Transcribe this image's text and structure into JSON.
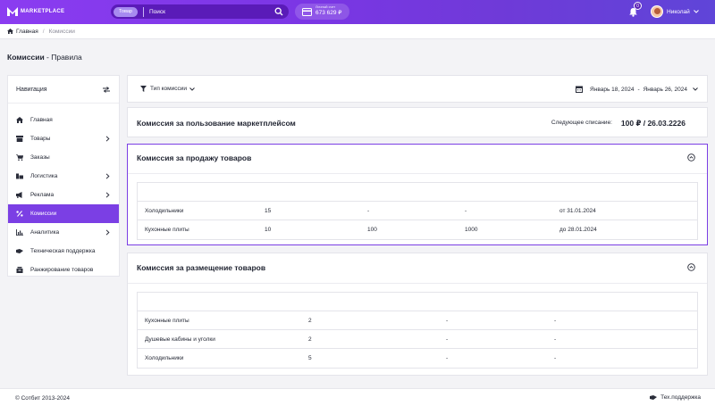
{
  "header": {
    "logo_text": "MARKETPLACE",
    "search_scope": "Товар",
    "search_placeholder": "Поиск",
    "wallet_label": "Личный счет",
    "wallet_amount": "673 629 ₽",
    "notifications_count": "0",
    "user_name": "Николай",
    "accent": "#7b3fe4"
  },
  "breadcrumb": {
    "home": "Главная",
    "sep": "/",
    "current": "Комиссии"
  },
  "page": {
    "title_bold": "Комиссии",
    "title_rest": " - Правила"
  },
  "sidebar": {
    "title": "Навигация",
    "items": [
      {
        "label": "Главная",
        "icon": "home-icon"
      },
      {
        "label": "Товары",
        "icon": "box-icon",
        "has_children": true
      },
      {
        "label": "Заказы",
        "icon": "cart-icon"
      },
      {
        "label": "Логистика",
        "icon": "truck-icon",
        "has_children": true
      },
      {
        "label": "Реклама",
        "icon": "megaphone-icon",
        "has_children": true
      },
      {
        "label": "Комиссии",
        "icon": "percent-icon",
        "active": true
      },
      {
        "label": "Аналитика",
        "icon": "chart-icon",
        "has_children": true
      },
      {
        "label": "Техническая поддержка",
        "icon": "support-icon"
      },
      {
        "label": "Ранжирование товаров",
        "icon": "ranking-icon"
      }
    ]
  },
  "filters": {
    "type_label": "Тип комиссии",
    "date_from": "Январь 18, 2024",
    "date_sep": "-",
    "date_to": "Январь 26, 2024"
  },
  "marketplace_fee": {
    "title": "Комиссия за пользование маркетплейсом",
    "next_label": "Следующее списание:",
    "next_value": "100 ₽ / 26.03.2226"
  },
  "sale_fee": {
    "title": "Комиссия за продажу товаров",
    "rows": [
      [
        "Холодильники",
        "15",
        "-",
        "-",
        "от 31.01.2024"
      ],
      [
        "Кухонные плиты",
        "10",
        "100",
        "1000",
        "до 28.01.2024"
      ]
    ]
  },
  "placement_fee": {
    "title": "Комиссия за размещение товаров",
    "rows": [
      [
        "Кухонные плиты",
        "2",
        "-",
        "-"
      ],
      [
        "Душевые кабины и уголки",
        "2",
        "-",
        "-"
      ],
      [
        "Холодильники",
        "5",
        "-",
        "-"
      ]
    ]
  },
  "footer": {
    "copyright": "© Сотбит 2013-2024",
    "support": "Тех.поддержка"
  }
}
